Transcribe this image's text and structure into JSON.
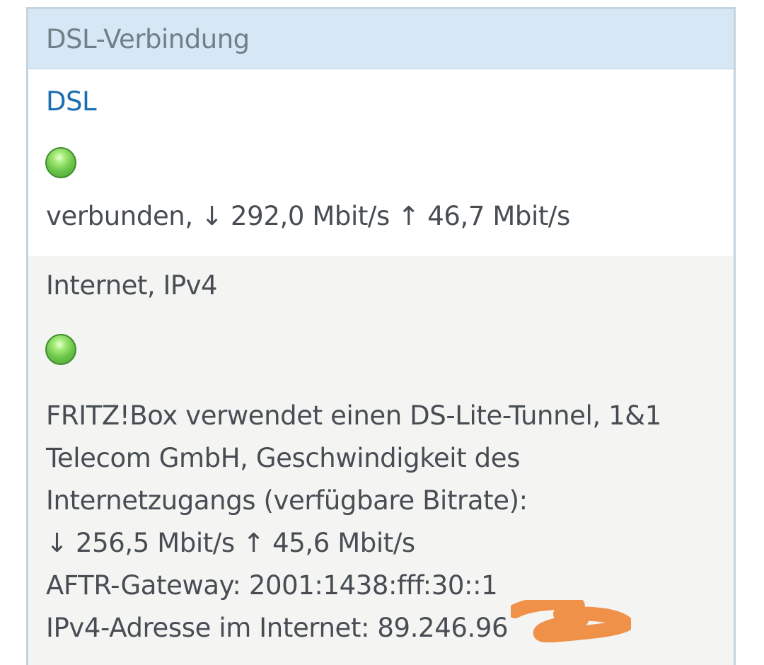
{
  "panel": {
    "title": "DSL-Verbindung"
  },
  "dsl": {
    "label": "DSL",
    "status_icon": "green-status-led",
    "status_text": "verbunden, ↓ 292,0 Mbit/s ↑ 46,7 Mbit/s"
  },
  "internet": {
    "label": "Internet, IPv4",
    "status_icon": "green-status-led",
    "lines": [
      "FRITZ!Box verwendet einen DS-Lite-Tunnel, 1&1",
      "Telecom GmbH, Geschwindigkeit des",
      "Internetzugangs (verfügbare Bitrate):",
      "↓ 256,5 Mbit/s ↑ 45,6 Mbit/s",
      "AFTR-Gateway: 2001:1438:fff:30::1",
      "IPv4-Adresse im Internet: 89.246.96"
    ]
  },
  "colors": {
    "header_bg": "#d6e7f5",
    "link": "#1b6db1",
    "status_green": "#6cc54a",
    "redaction": "#f0914a"
  }
}
